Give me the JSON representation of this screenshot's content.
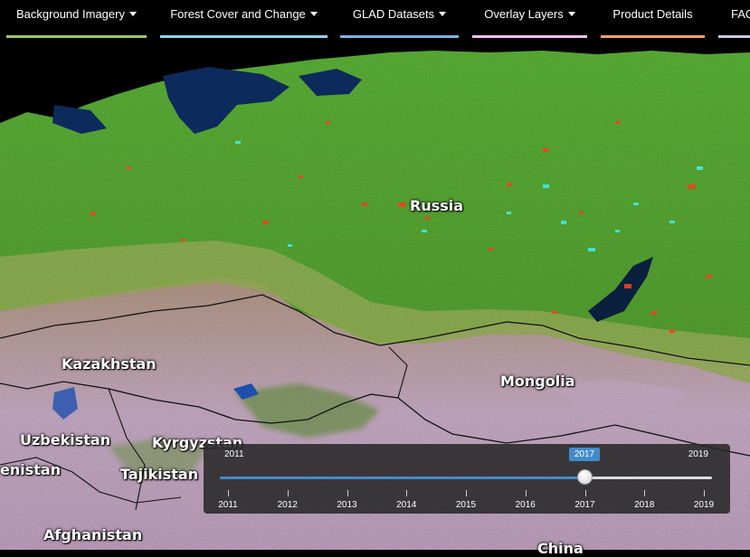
{
  "nav": {
    "items": [
      {
        "label": "Background Imagery",
        "caret": true,
        "color": "#9ccb5a"
      },
      {
        "label": "Forest Cover and Change",
        "caret": true,
        "color": "#8fd3e8"
      },
      {
        "label": "GLAD Datasets",
        "caret": true,
        "color": "#7fb3df"
      },
      {
        "label": "Overlay Layers",
        "caret": true,
        "color": "#f0c0ec"
      },
      {
        "label": "Product Details",
        "caret": false,
        "color": "#f2a65a"
      },
      {
        "label": "FAQ",
        "caret": false,
        "color": "#c9c9e8"
      }
    ]
  },
  "map": {
    "labels": [
      {
        "id": "russia",
        "text": "Russia"
      },
      {
        "id": "kazakhstan",
        "text": "Kazakhstan"
      },
      {
        "id": "mongolia",
        "text": "Mongolia"
      },
      {
        "id": "uzbekistan",
        "text": "Uzbekistan"
      },
      {
        "id": "kyrgyzstan",
        "text": "Kyrgyzstan"
      },
      {
        "id": "tajikistan",
        "text": "Tajikistan"
      },
      {
        "id": "turkmenistan",
        "text": "enistan"
      },
      {
        "id": "afghanistan",
        "text": "Afghanistan"
      },
      {
        "id": "china",
        "text": "China"
      }
    ],
    "colors": {
      "forest": "#4aa82c",
      "steppe": "#b8a690",
      "desert": "#d9b8d6",
      "water": "#0d2a5c",
      "loss": "#e8451e",
      "gain": "#3ef0f0"
    }
  },
  "timeslider": {
    "min_label": "2011",
    "max_label": "2019",
    "current_label": "2017",
    "min": 2011,
    "max": 2019,
    "value": 2017,
    "ticks": [
      "2011",
      "2012",
      "2013",
      "2014",
      "2015",
      "2016",
      "2017",
      "2018",
      "2019"
    ],
    "accent": "#428bca"
  }
}
